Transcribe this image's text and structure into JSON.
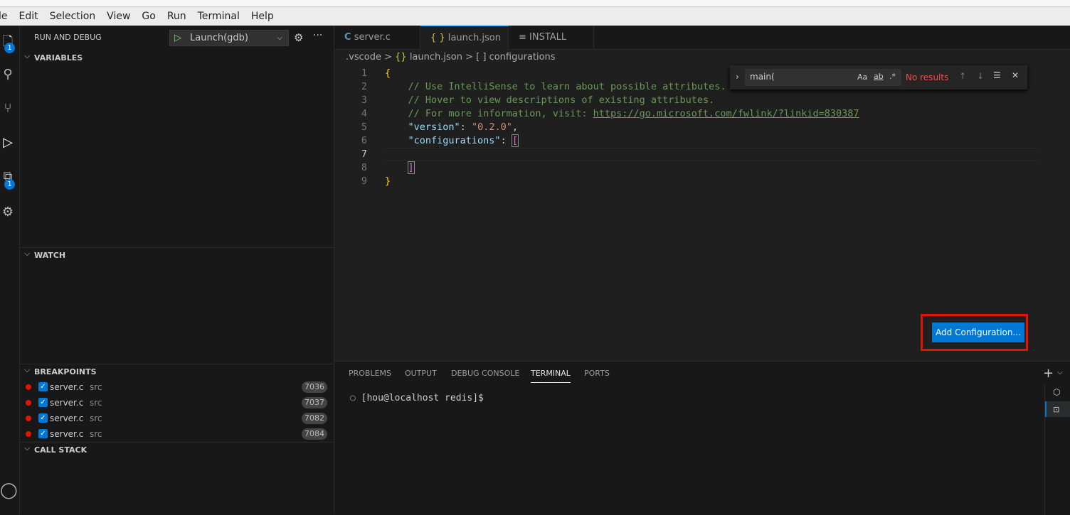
{
  "menu": [
    "le",
    "Edit",
    "Selection",
    "View",
    "Go",
    "Run",
    "Terminal",
    "Help"
  ],
  "activity": {
    "explorer_badge": "1",
    "extensions_badge": "1"
  },
  "sidebar": {
    "title": "RUN AND DEBUG",
    "launch_config": "Launch(gdb)",
    "sections": {
      "variables": "VARIABLES",
      "watch": "WATCH",
      "breakpoints": "BREAKPOINTS",
      "call_stack": "CALL STACK"
    },
    "breakpoints": [
      {
        "file": "server.c",
        "dir": "src",
        "line": "7036"
      },
      {
        "file": "server.c",
        "dir": "src",
        "line": "7037"
      },
      {
        "file": "server.c",
        "dir": "src",
        "line": "7082"
      },
      {
        "file": "server.c",
        "dir": "src",
        "line": "7084"
      }
    ]
  },
  "tabs": [
    {
      "label": "server.c",
      "icon": "C"
    },
    {
      "label": "launch.json",
      "icon": "{ }",
      "active": true,
      "dirty": true
    },
    {
      "label": "INSTALL",
      "icon": "≡"
    }
  ],
  "breadcrumb": [
    ".vscode",
    "launch.json",
    "configurations"
  ],
  "editor": {
    "lines": [
      {
        "n": "1",
        "t": "{"
      },
      {
        "n": "2",
        "t": "    // Use IntelliSense to learn about possible attributes."
      },
      {
        "n": "3",
        "t": "    // Hover to view descriptions of existing attributes."
      },
      {
        "n": "4",
        "t": "    // For more information, visit: ",
        "link": "https://go.microsoft.com/fwlink/?linkid=830387"
      },
      {
        "n": "5",
        "k": "\"version\"",
        "v": "\"0.2.0\""
      },
      {
        "n": "6",
        "k": "\"configurations\""
      },
      {
        "n": "7",
        "t": ""
      },
      {
        "n": "8",
        "t": "    ]"
      },
      {
        "n": "9",
        "t": "}"
      }
    ]
  },
  "find": {
    "query": "main(",
    "match_case": "Aa",
    "whole_word": "ab",
    "regex": ".*",
    "status": "No results"
  },
  "add_configuration": "Add Configuration...",
  "panel": {
    "tabs": [
      "PROBLEMS",
      "OUTPUT",
      "DEBUG CONSOLE",
      "TERMINAL",
      "PORTS"
    ],
    "active": "TERMINAL",
    "prompt": "[hou@localhost redis]$"
  },
  "colors": {
    "accent": "#0078d4",
    "highlight_box": "#e51400",
    "breakpoint": "#e51400"
  }
}
